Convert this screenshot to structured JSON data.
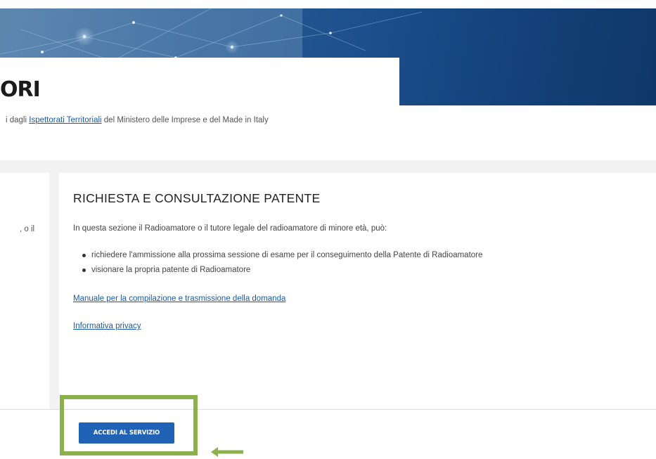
{
  "header": {
    "title_fragment": "ORI",
    "subtitle": {
      "prefix": "i dagli ",
      "link_text": "Ispettorati Territoriali",
      "suffix": " del Ministero delle Imprese e del Made in Italy"
    }
  },
  "left_card": {
    "text": ", o il"
  },
  "service_card": {
    "title": "RICHIESTA E CONSULTAZIONE PATENTE",
    "intro": "In questa sezione il Radioamatore o il tutore legale del radioamatore di minore età, può:",
    "bullets": [
      "richiedere l'ammissione alla prossima sessione di esame per il conseguimento della Patente di Radioamatore",
      "visionare la propria patente di Radioamatore"
    ],
    "links": {
      "manual": "Manuale per la compilazione e trasmissione della domanda",
      "privacy": "Informativa privacy"
    },
    "button_label": "ACCEDI AL SERVIZIO"
  },
  "annotation": {
    "highlight_color": "#8db14a",
    "arrow_color": "#8db14a"
  },
  "colors": {
    "accent": "#1f62b6",
    "link": "#1a5aa8",
    "hero": "#134078"
  }
}
